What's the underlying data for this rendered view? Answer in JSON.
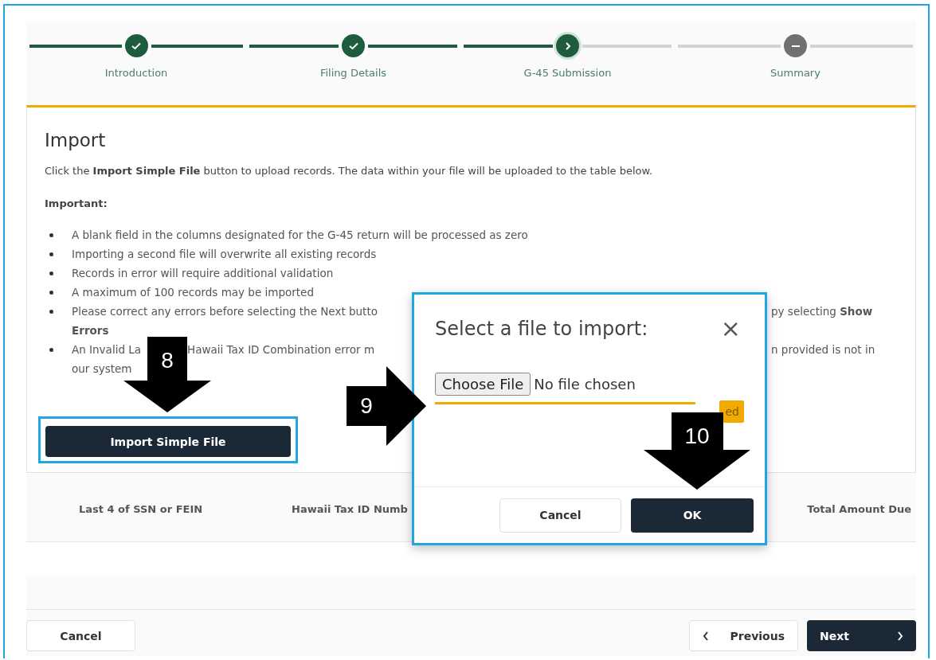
{
  "stepper": {
    "steps": [
      {
        "label": "Introduction",
        "done": true,
        "selected": false
      },
      {
        "label": "Filing Details",
        "done": true,
        "selected": false
      },
      {
        "label": "G-45 Submission",
        "done": false,
        "selected": true
      },
      {
        "label": "Summary",
        "done": false,
        "selected": false
      }
    ]
  },
  "import_section": {
    "title": "Import",
    "intro": "Click the **Import Simple File** button to upload records. The data within your file will be uploaded to the table below.",
    "important_label": "Important:",
    "lines": [
      {
        "kind": "bullet",
        "left": [
          "A blank field in the columns designated for the G-45 return will be processed as zero"
        ]
      },
      {
        "kind": "bullet",
        "left": [
          "Importing a second file will overwrite all existing records"
        ]
      },
      {
        "kind": "bullet",
        "left": [
          "Records in error will require additional validation"
        ]
      },
      {
        "kind": "bullet",
        "left": [
          "A maximum of 100 records may be imported"
        ]
      },
      {
        "kind": "bullet",
        "left": [
          "Please correct any errors before selecting the Next butto"
        ],
        "right": "py selecting **Show**"
      },
      {
        "kind": "continuation",
        "left": [
          "**Errors**"
        ]
      },
      {
        "kind": "bullet",
        "left": [
          "An Invalid La",
          "Hawaii Tax ID Combination error m"
        ],
        "right": "n provided is not in"
      },
      {
        "kind": "continuation",
        "left": [
          "our system"
        ]
      }
    ],
    "button": "Import Simple File"
  },
  "table": {
    "columns": [
      "Last 4 of SSN or FEIN",
      "Hawaii Tax ID Numb",
      "Total Amount Due"
    ]
  },
  "footer": {
    "cancel": "Cancel",
    "previous": "Previous",
    "next": "Next"
  },
  "dialog": {
    "title": "Select a file to import:",
    "close": "×",
    "choose_button": "Choose File",
    "file_status": "No file chosen",
    "partial_button": "ed",
    "cancel": "Cancel",
    "ok": "OK"
  },
  "annotations": [
    {
      "number": "8",
      "kind": "down"
    },
    {
      "number": "9",
      "kind": "right"
    },
    {
      "number": "10",
      "kind": "down"
    }
  ]
}
